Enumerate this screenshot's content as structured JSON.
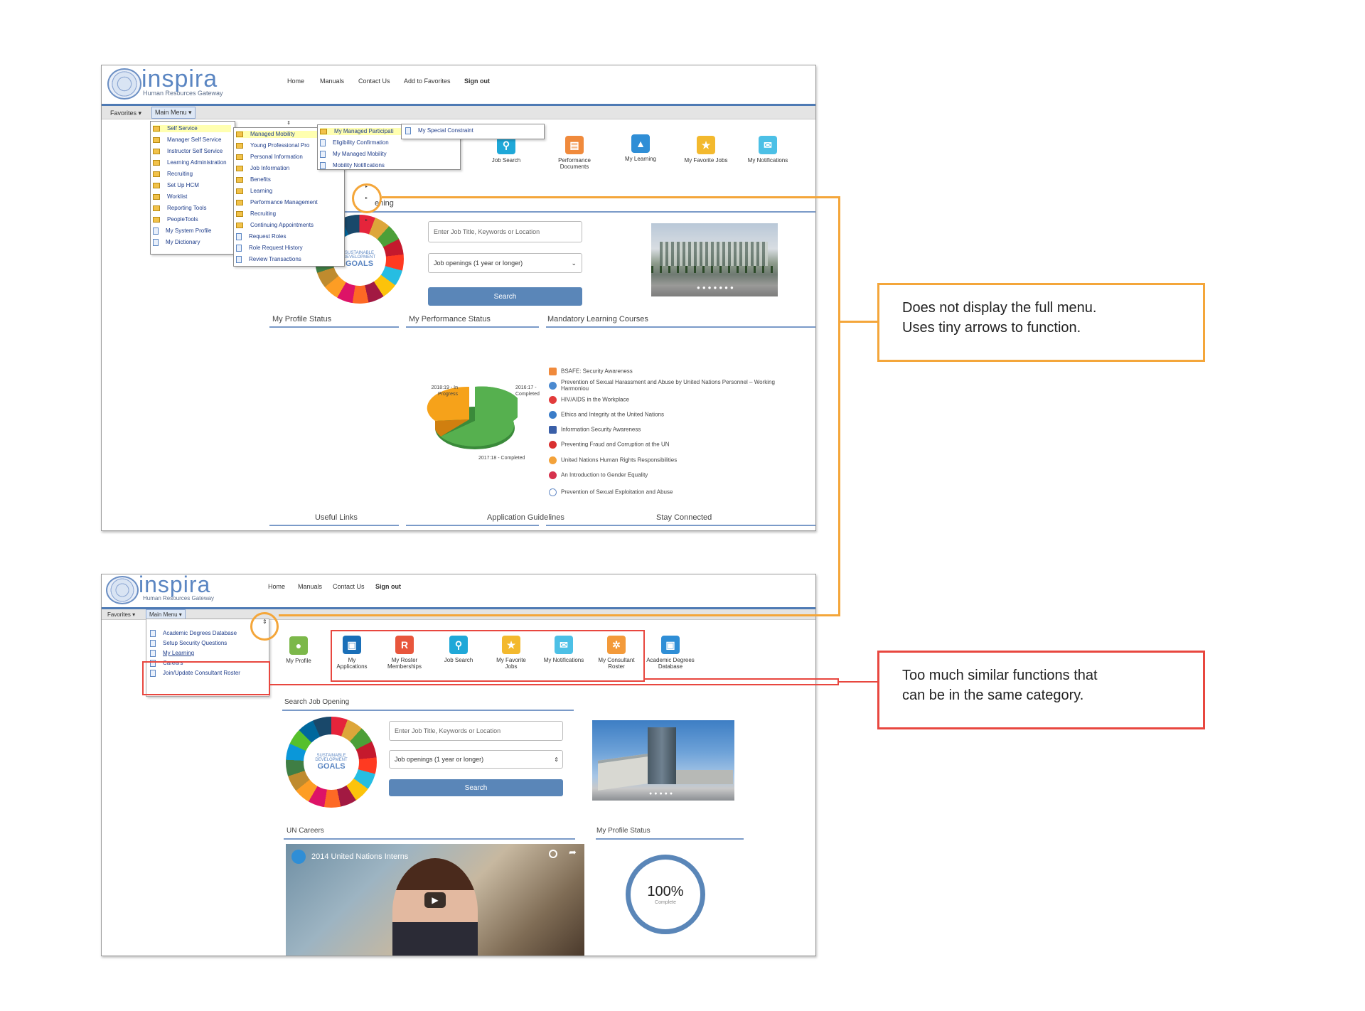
{
  "screen1": {
    "logo_text": "inspira",
    "logo_sub": "Human Resources Gateway",
    "nav": [
      "Home",
      "Manuals",
      "Contact Us",
      "Add to Favorites",
      "Sign out"
    ],
    "menubar": {
      "favorites": "Favorites ▾",
      "main_menu": "Main Menu ▾"
    },
    "menu_col1": [
      "Self Service",
      "Manager Self Service",
      "Instructor Self Service",
      "Learning Administration",
      "Recruiting",
      "Set Up HCM",
      "Worklist",
      "Reporting Tools",
      "PeopleTools",
      "My System Profile",
      "My Dictionary"
    ],
    "menu_col2": [
      "Managed Mobility",
      "Young Professional Pro",
      "Personal Information",
      "Job Information",
      "Benefits",
      "Learning",
      "Performance Management",
      "Recruiting",
      "Continuing Appointments",
      "Request Roles",
      "Role Request History",
      "Review Transactions"
    ],
    "menu_col3": [
      "My Managed Participati",
      "Eligibility Confirmation",
      "My Managed Mobility",
      "Mobility Notifications"
    ],
    "menu_col4": [
      "My Special Constraint"
    ],
    "tiles": [
      {
        "label": "Job Search",
        "icon": "search-icon",
        "color": "#1fa8d8"
      },
      {
        "label": "Performance Documents",
        "icon": "document-icon",
        "color": "#f08a3c"
      },
      {
        "label": "My Learning",
        "icon": "graduation-cap-icon",
        "color": "#2f8ed6"
      },
      {
        "label": "My Favorite Jobs",
        "icon": "star-icon",
        "color": "#f3b92e"
      },
      {
        "label": "My Notifications",
        "icon": "envelope-icon",
        "color": "#4cc0e6"
      }
    ],
    "search_tail": "ening",
    "search_placeholder": "Enter Job Title, Keywords or Location",
    "select_value": "Job openings (1 year or longer)",
    "search_button": "Search",
    "sdg_label": [
      "SUSTAINABLE",
      "DEVELOPMENT",
      "GOALS"
    ],
    "sections": {
      "profile": "My Profile Status",
      "performance": "My Performance Status",
      "mandatory": "Mandatory Learning Courses",
      "useful": "Useful Links",
      "guidelines": "Application Guidelines",
      "connected": "Stay Connected"
    },
    "pie_labels": {
      "in_progress": "2018:19 - In Progress",
      "completed_16": "2016:17 - Completed",
      "completed_17": "2017:18 - Completed"
    },
    "courses": [
      {
        "title": "BSAFE: Security Awareness",
        "color": "#f08a3c"
      },
      {
        "title": "Prevention of Sexual Harassment and Abuse by United Nations Personnel – Working Harmoniou",
        "color": "#4b8ad0"
      },
      {
        "title": "HIV/AIDS in the Workplace",
        "color": "#e23b3b"
      },
      {
        "title": "Ethics and Integrity at the United Nations",
        "color": "#3a7cc8"
      },
      {
        "title": "Information Security Awareness",
        "color": "#3a5fa8"
      },
      {
        "title": "Preventing Fraud and Corruption at the UN",
        "color": "#d93030"
      },
      {
        "title": "United Nations Human Rights Responsibilities",
        "color": "#f3a23a"
      },
      {
        "title": "An Introduction to Gender Equality",
        "color": "#d6324d"
      },
      {
        "title": "Prevention of Sexual Exploitation and Abuse",
        "color": "#6a8fc8"
      }
    ]
  },
  "screen2": {
    "logo_text": "inspira",
    "logo_sub": "Human Resources Gateway",
    "nav": [
      "Home",
      "Manuals",
      "Contact Us",
      "Sign out"
    ],
    "menubar": {
      "favorites": "Favorites ▾",
      "main_menu": "Main Menu ▾"
    },
    "menu_items": [
      "Academic Degrees Database",
      "Setup Security Questions",
      "My Learning",
      "Careers",
      "Join/Update Consultant Roster"
    ],
    "tiles": [
      {
        "label": "My Profile",
        "icon": "person-icon",
        "color": "#7cb84a"
      },
      {
        "label": "My Applications",
        "icon": "briefcase-icon",
        "color": "#1a6fb8"
      },
      {
        "label": "My Roster Memberships",
        "icon": "roster-r-icon",
        "color": "#e8563c"
      },
      {
        "label": "Job Search",
        "icon": "search-icon",
        "color": "#1fa8d8"
      },
      {
        "label": "My Favorite Jobs",
        "icon": "star-icon",
        "color": "#f3b92e"
      },
      {
        "label": "My Notifications",
        "icon": "envelope-icon",
        "color": "#4cc0e6"
      },
      {
        "label": "My Consultant Roster",
        "icon": "consultant-icon",
        "color": "#f39a3a"
      },
      {
        "label": "Academic Degrees Database",
        "icon": "institution-icon",
        "color": "#2f8ed6"
      }
    ],
    "search_title": "Search Job Opening",
    "search_placeholder": "Enter Job Title, Keywords or Location",
    "select_value": "Job openings (1 year or longer)",
    "search_button": "Search",
    "sdg_label": [
      "SUSTAINABLE",
      "DEVELOPMENT",
      "GOALS"
    ],
    "careers_title": "UN Careers",
    "video_title": "2014 United Nations Interns",
    "profile_title": "My Profile Status",
    "profile_percent": "100%",
    "profile_sub": "Complete"
  },
  "annotations": {
    "menu_note": [
      "Does not display the full menu.",
      "Uses tiny arrows to function."
    ],
    "tiles_note": [
      "Too much similar functions that",
      "can be in the same category."
    ]
  },
  "colors": {
    "orange": "#f4a63a",
    "red": "#e8473f",
    "brand_blue": "#5b86c2"
  }
}
